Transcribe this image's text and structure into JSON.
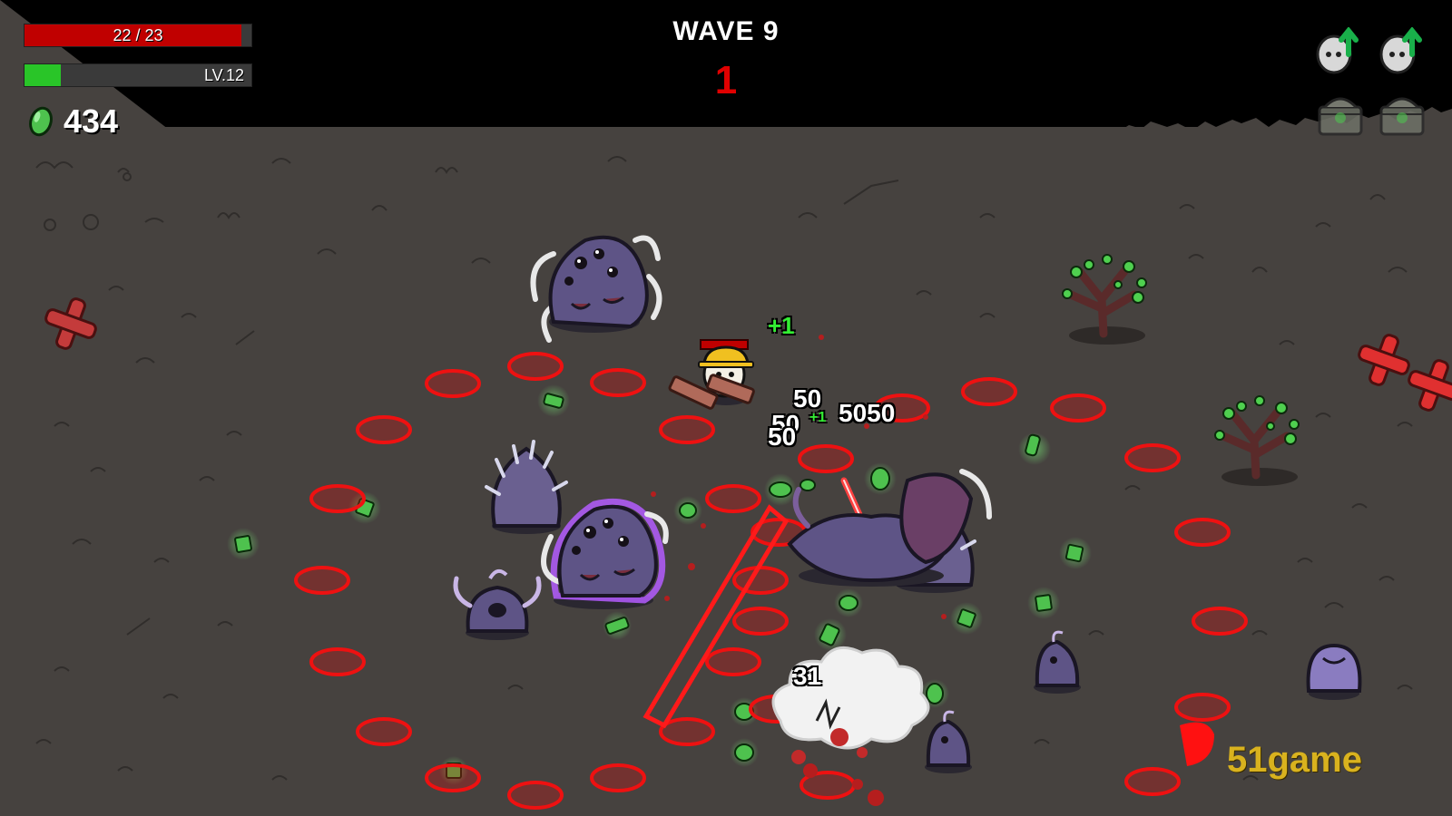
{
  "hud": {
    "health_text": "22 / 23",
    "health": {
      "current": 22,
      "max": 23
    },
    "level_text": "LV.12",
    "xp_fraction": 0.16,
    "materials_count": "434",
    "wave_title": "WAVE 9",
    "wave_timer": "1",
    "upgrades_pending": 2,
    "crates_pending": 2
  },
  "floating_text": {
    "damage_a": "50",
    "damage_b": "50",
    "damage_c": "50",
    "damage_d": "5050",
    "damage_e": "31",
    "gain_main": "+1",
    "gain_small": "+1"
  },
  "watermark": "51game",
  "colors": {
    "ground": "#46423f",
    "hud_black": "#000000",
    "health_red": "#c00000",
    "xp_green": "#29c528",
    "timer_red": "#e00000",
    "material_green": "#4ec24e",
    "enemy_purple": "#5e5486",
    "spawn_marker_red": "#ee1111",
    "watermark_gold": "#d9b21e"
  }
}
